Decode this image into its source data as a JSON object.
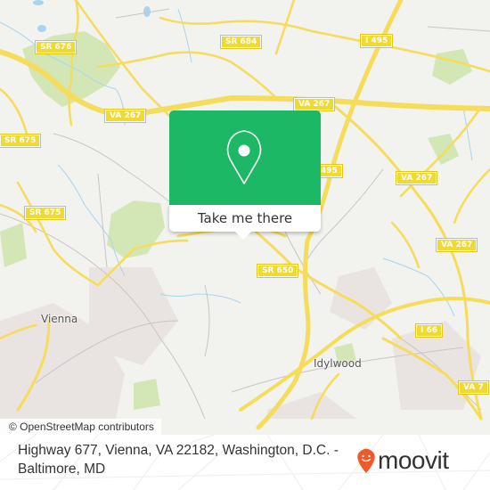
{
  "map": {
    "road_shields": [
      {
        "id": "sr676",
        "label": "SR 676"
      },
      {
        "id": "sr684",
        "label": "SR 684"
      },
      {
        "id": "i495-top",
        "label": "I 495"
      },
      {
        "id": "va267-left",
        "label": "VA 267"
      },
      {
        "id": "va267-mid",
        "label": "VA 267"
      },
      {
        "id": "sr675-top",
        "label": "SR 675"
      },
      {
        "id": "sr675-bottom",
        "label": "SR 675"
      },
      {
        "id": "i495-partial",
        "label": "495"
      },
      {
        "id": "va267-right1",
        "label": "VA 267"
      },
      {
        "id": "va267-right2",
        "label": "VA 267"
      },
      {
        "id": "sr650",
        "label": "SR 650"
      },
      {
        "id": "i66",
        "label": "I 66"
      },
      {
        "id": "va7",
        "label": "VA 7"
      }
    ],
    "places": [
      {
        "id": "vienna",
        "label": "Vienna"
      },
      {
        "id": "idylwood",
        "label": "Idylwood"
      }
    ],
    "colors": {
      "land": "#f2f2ef",
      "road_major": "#f5dc5a",
      "road_minor": "#c9c5c0",
      "park": "#cfe3ae",
      "water": "#a8d4f0",
      "urban": "#e8e2df"
    }
  },
  "popup": {
    "icon": "map-pin-icon",
    "action_label": "Take me there",
    "color": "#1db865"
  },
  "attribution": "© OpenStreetMap contributors",
  "footer": {
    "address": "Highway 677, Vienna, VA 22182, Washington, D.C. - Baltimore, MD",
    "brand": "moovit",
    "brand_color": "#f0592a"
  }
}
